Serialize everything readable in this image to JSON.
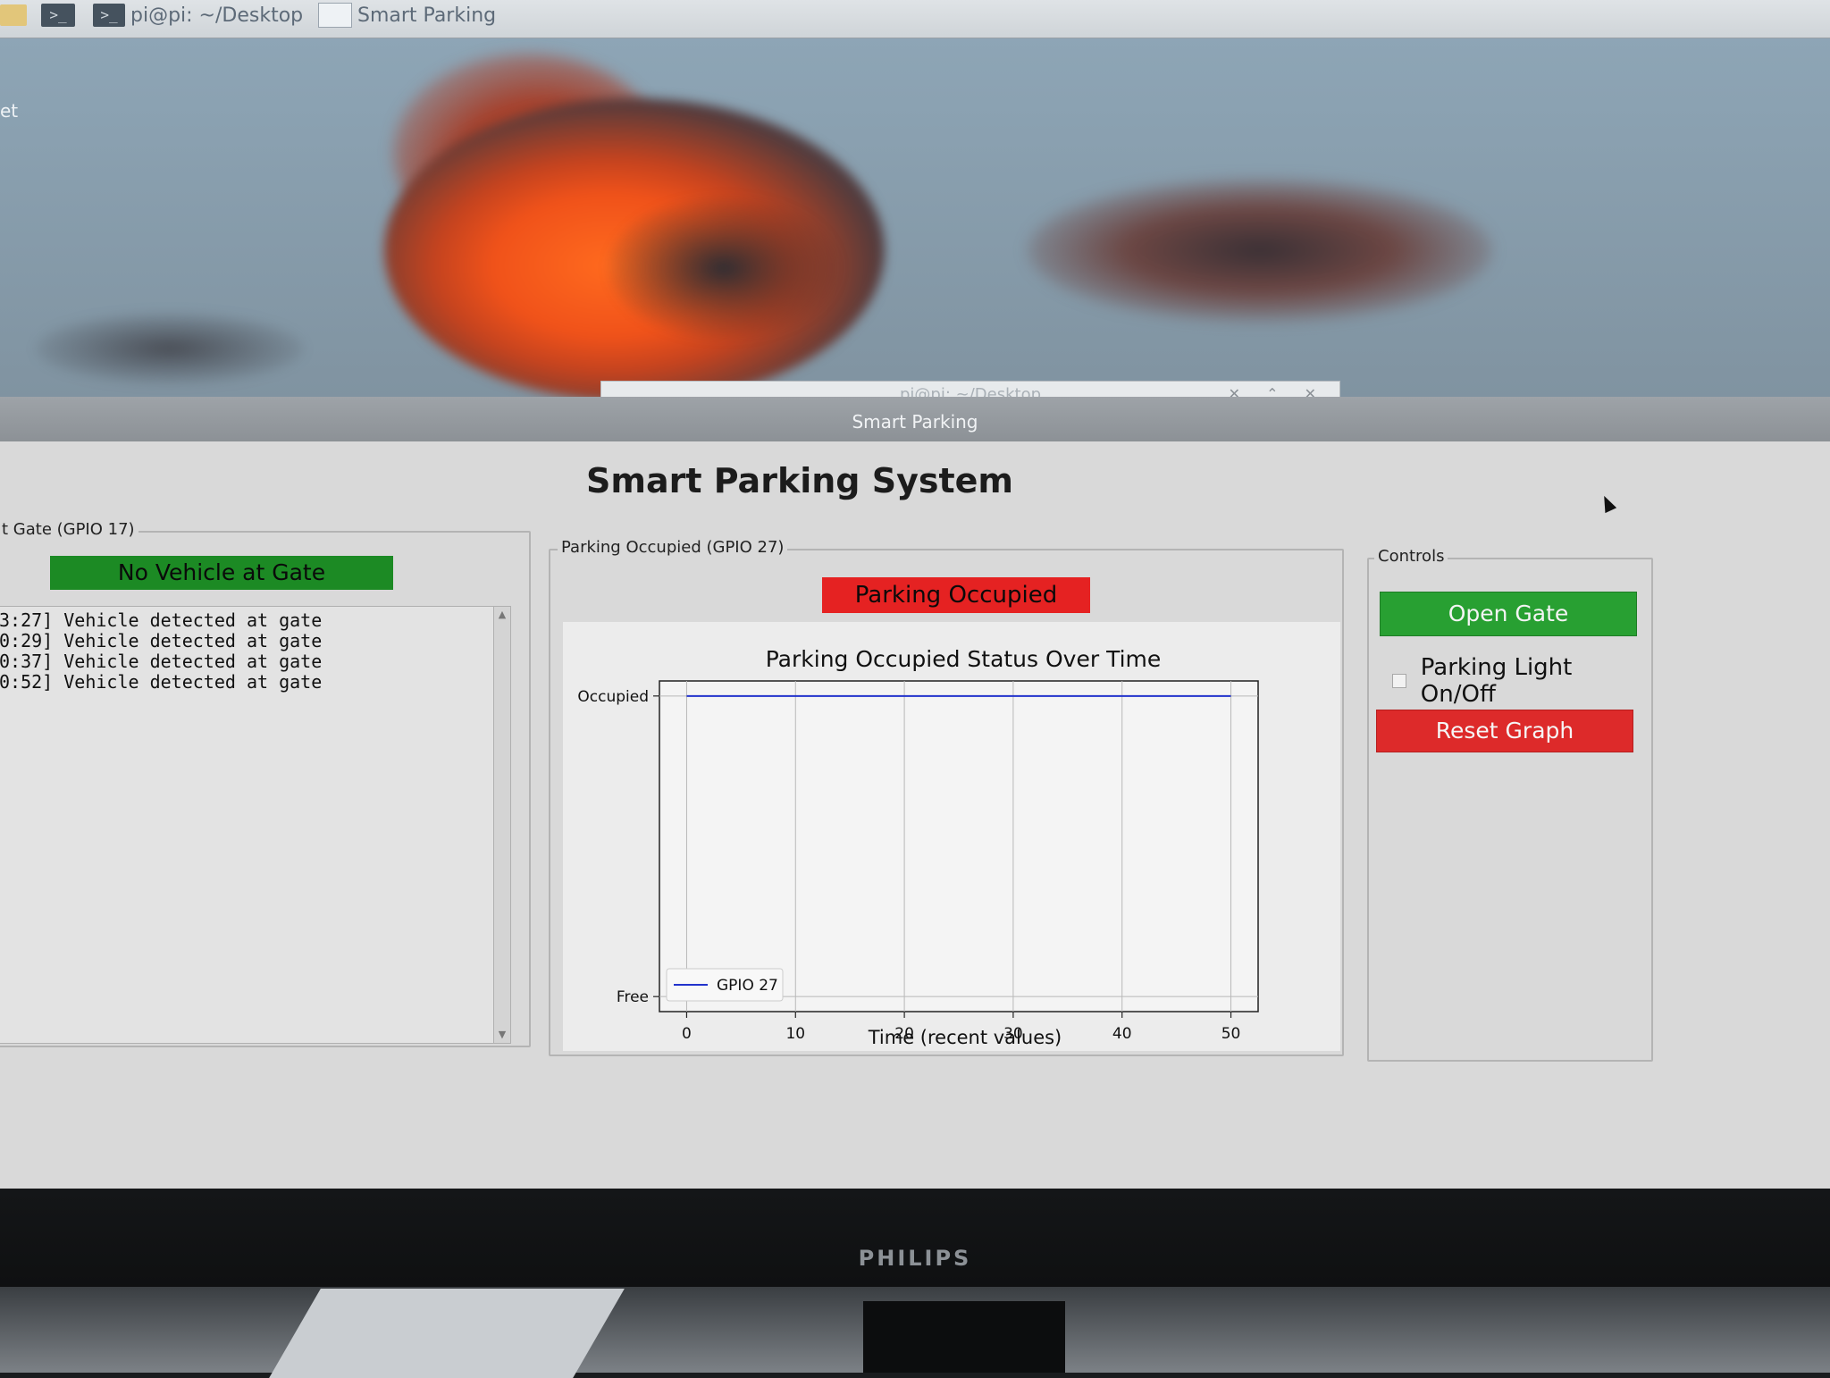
{
  "taskbar": {
    "items": [
      {
        "label": "pi@pi: ~/Desktop",
        "icon": "terminal-icon"
      },
      {
        "label": "Smart Parking",
        "icon": "window-icon"
      }
    ]
  },
  "desktop": {
    "partial_label": "et"
  },
  "background_window": {
    "title": "pi@pi: ~/Desktop"
  },
  "window": {
    "title": "Smart Parking"
  },
  "app": {
    "heading": "Smart Parking System"
  },
  "gate": {
    "frame_label": "t Gate (GPIO 17)",
    "status": "No Vehicle at Gate",
    "status_color": "#1c8a24",
    "log": [
      "3:27] Vehicle detected at gate",
      "0:29] Vehicle detected at gate",
      "0:37] Vehicle detected at gate",
      "0:52] Vehicle detected at gate"
    ]
  },
  "parking": {
    "frame_label": "Parking Occupied (GPIO 27)",
    "status": "Parking Occupied",
    "status_color": "#e52222"
  },
  "controls": {
    "frame_label": "Controls",
    "open_gate": "Open Gate",
    "light_toggle": "Parking Light On/Off",
    "light_checked": false,
    "reset_graph": "Reset Graph",
    "open_gate_color": "#28a032",
    "reset_color": "#dd2a2a"
  },
  "monitor": {
    "brand": "PHILIPS"
  },
  "chart_data": {
    "type": "line",
    "title": "Parking Occupied Status Over Time",
    "xlabel": "Time (recent values)",
    "ylabel": "",
    "xlim": [
      -2.5,
      52.5
    ],
    "ylim": [
      -0.05,
      1.05
    ],
    "x_ticks": [
      0,
      10,
      20,
      30,
      40,
      50
    ],
    "y_ticks": [
      {
        "value": 0,
        "label": "Free"
      },
      {
        "value": 1,
        "label": "Occupied"
      }
    ],
    "grid": true,
    "legend": "bottom-left",
    "series": [
      {
        "name": "GPIO 27",
        "color": "#2233cc",
        "x": [
          0,
          10,
          20,
          30,
          40,
          50
        ],
        "y": [
          1,
          1,
          1,
          1,
          1,
          1
        ]
      }
    ]
  }
}
